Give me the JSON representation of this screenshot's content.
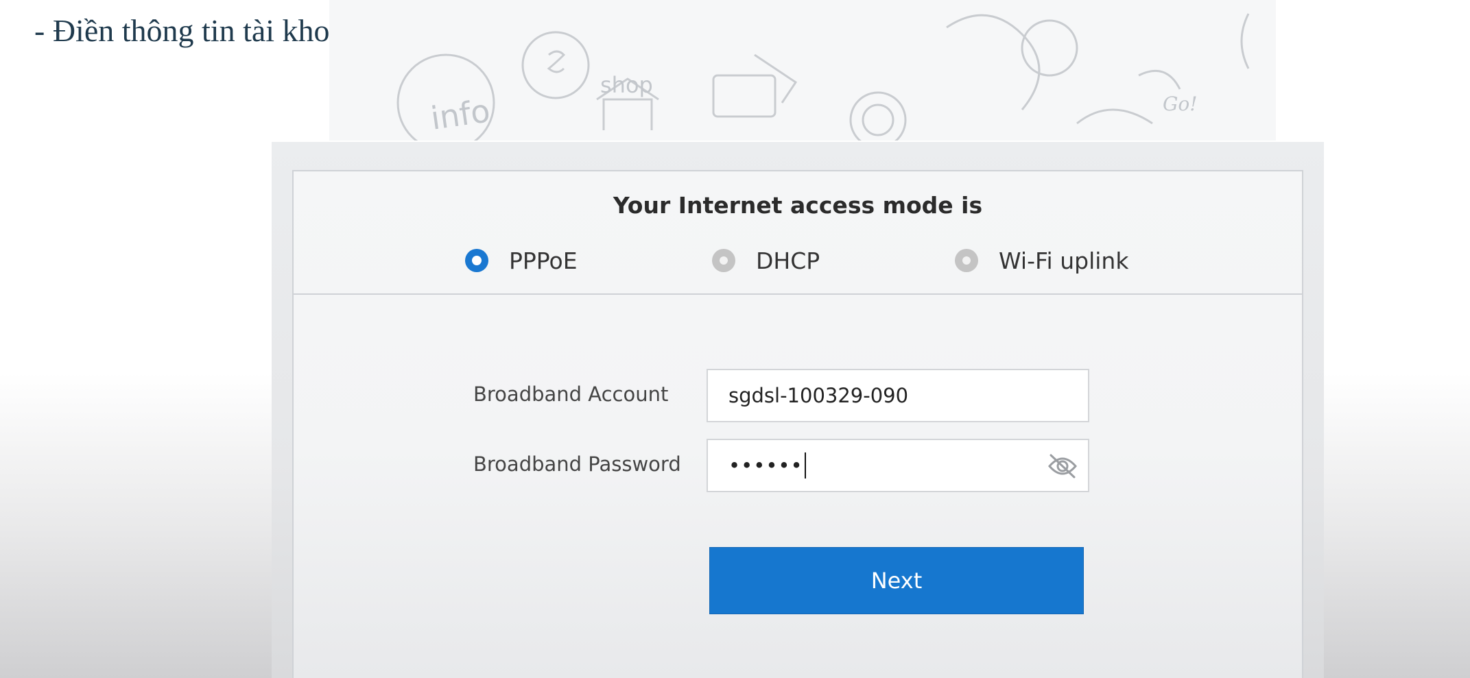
{
  "caption": "- Điền thông tin tài khoản/mật khẩu PPPoE của khách hàng và bấm Next",
  "background_doodle_words": [
    "info",
    "shop",
    "Go!"
  ],
  "access_mode": {
    "title": "Your Internet access mode is",
    "options": [
      {
        "label": "PPPoE",
        "selected": true
      },
      {
        "label": "DHCP",
        "selected": false
      },
      {
        "label": "Wi-Fi uplink",
        "selected": false
      }
    ]
  },
  "form": {
    "account_label": "Broadband Account",
    "account_value": "sgdsl-100329-090",
    "password_label": "Broadband Password",
    "password_masked": "••••••",
    "password_toggle_icon": "eye-slash-icon"
  },
  "next_label": "Next",
  "colors": {
    "accent": "#1677cf",
    "radio_selected": "#1a78d1",
    "radio_unselected": "#c4c4c4",
    "caption_text": "#1f3a4d"
  }
}
